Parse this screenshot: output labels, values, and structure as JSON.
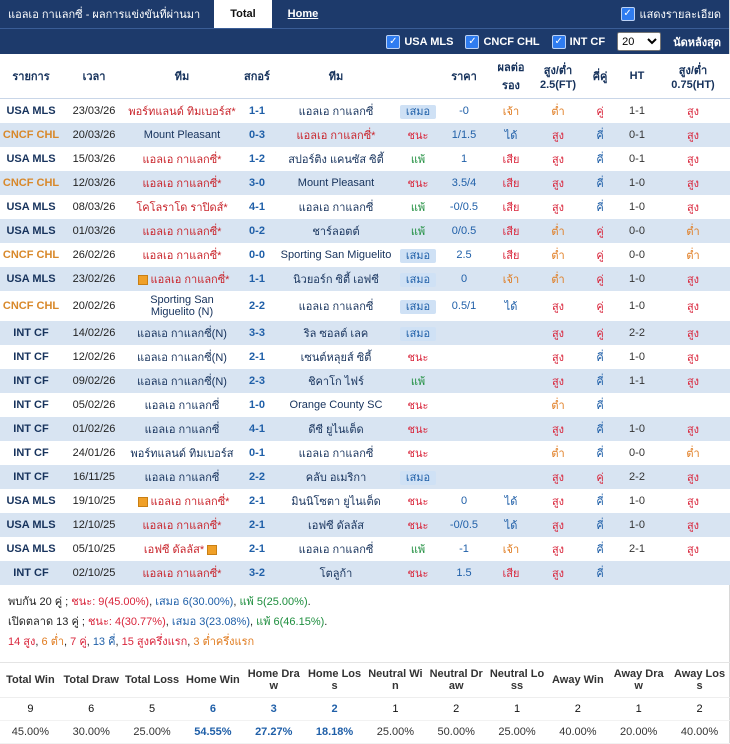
{
  "icons": {
    "check": "✓"
  },
  "titlebar": {
    "title": "แอลเอ กาแลกซี่ - ผลการแข่งขันที่ผ่านมา",
    "tabs": [
      {
        "label": "Total",
        "active": true
      },
      {
        "label": "Home",
        "active": false
      }
    ],
    "detail_label": "แสดงรายละเอียด"
  },
  "filterbar": {
    "leagues": [
      "USA MLS",
      "CNCF CHL",
      "INT CF"
    ],
    "match_count": "20",
    "match_count_label": "นัดหลังสุด"
  },
  "table": {
    "headers": [
      "รายการ",
      "เวลา",
      "ทีม",
      "สกอร์",
      "ทีม",
      "",
      "ราคา",
      "ผลต่อรอง",
      "สูง/ต่ำ 2.5(FT)",
      "คี่คู่",
      "HT",
      "สูง/ต่ำ 0.75(HT)"
    ],
    "rows": [
      {
        "league": "USA MLS",
        "league_type": "navy",
        "date": "23/03/26",
        "home": "พอร์ทแลนด์ ทิมเบอร์ส*",
        "home_fav": true,
        "home_icon": "",
        "score": "1-1",
        "away": "แอลเอ กาแลกซี่",
        "away_fav": false,
        "result": "เสมอ",
        "result_type": "draw",
        "price": "-0",
        "odds": "เจ้า",
        "odds_type": "push",
        "ou": "ต่ำ",
        "ou_type": "under",
        "oe": "คู่",
        "oe_type": "even",
        "ht": "1-1",
        "ht_ou": "สูง",
        "ht_ou_type": "over"
      },
      {
        "league": "CNCF CHL",
        "league_type": "orange",
        "date": "20/03/26",
        "home": "Mount Pleasant",
        "home_fav": false,
        "home_icon": "",
        "score": "0-3",
        "away": "แอลเอ กาแลกซี่*",
        "away_fav": true,
        "result": "ชนะ",
        "result_type": "win",
        "price": "1/1.5",
        "odds": "ได้",
        "odds_type": "gain",
        "ou": "สูง",
        "ou_type": "over",
        "oe": "คี่",
        "oe_type": "odd",
        "ht": "0-1",
        "ht_ou": "สูง",
        "ht_ou_type": "over"
      },
      {
        "league": "USA MLS",
        "league_type": "navy",
        "date": "15/03/26",
        "home": "แอลเอ กาแลกซี่*",
        "home_fav": true,
        "home_icon": "",
        "score": "1-2",
        "away": "สปอร์ติง แคนซัส ซิตี้",
        "away_fav": false,
        "result": "แพ้",
        "result_type": "loss",
        "price": "1",
        "odds": "เสีย",
        "odds_type": "lose",
        "ou": "สูง",
        "ou_type": "over",
        "oe": "คี่",
        "oe_type": "odd",
        "ht": "0-1",
        "ht_ou": "สูง",
        "ht_ou_type": "over"
      },
      {
        "league": "CNCF CHL",
        "league_type": "orange",
        "date": "12/03/26",
        "home": "แอลเอ กาแลกซี่*",
        "home_fav": true,
        "home_icon": "",
        "score": "3-0",
        "away": "Mount Pleasant",
        "away_fav": false,
        "result": "ชนะ",
        "result_type": "win",
        "price": "3.5/4",
        "odds": "เสีย",
        "odds_type": "lose",
        "ou": "สูง",
        "ou_type": "over",
        "oe": "คี่",
        "oe_type": "odd",
        "ht": "1-0",
        "ht_ou": "สูง",
        "ht_ou_type": "over"
      },
      {
        "league": "USA MLS",
        "league_type": "navy",
        "date": "08/03/26",
        "home": "โคโลราโด ราปิดส์*",
        "home_fav": true,
        "home_icon": "",
        "score": "4-1",
        "away": "แอลเอ กาแลกซี่",
        "away_fav": false,
        "result": "แพ้",
        "result_type": "loss",
        "price": "-0/0.5",
        "odds": "เสีย",
        "odds_type": "lose",
        "ou": "สูง",
        "ou_type": "over",
        "oe": "คี่",
        "oe_type": "odd",
        "ht": "1-0",
        "ht_ou": "สูง",
        "ht_ou_type": "over"
      },
      {
        "league": "USA MLS",
        "league_type": "navy",
        "date": "01/03/26",
        "home": "แอลเอ กาแลกซี่*",
        "home_fav": true,
        "home_icon": "",
        "score": "0-2",
        "away": "ชาร์ลอตต์",
        "away_fav": false,
        "result": "แพ้",
        "result_type": "loss",
        "price": "0/0.5",
        "odds": "เสีย",
        "odds_type": "lose",
        "ou": "ต่ำ",
        "ou_type": "under",
        "oe": "คู่",
        "oe_type": "even",
        "ht": "0-0",
        "ht_ou": "ต่ำ",
        "ht_ou_type": "under"
      },
      {
        "league": "CNCF CHL",
        "league_type": "orange",
        "date": "26/02/26",
        "home": "แอลเอ กาแลกซี่*",
        "home_fav": true,
        "home_icon": "",
        "score": "0-0",
        "away": "Sporting San Miguelito",
        "away_fav": false,
        "result": "เสมอ",
        "result_type": "draw",
        "price": "2.5",
        "odds": "เสีย",
        "odds_type": "lose",
        "ou": "ต่ำ",
        "ou_type": "under",
        "oe": "คู่",
        "oe_type": "even",
        "ht": "0-0",
        "ht_ou": "ต่ำ",
        "ht_ou_type": "under"
      },
      {
        "league": "USA MLS",
        "league_type": "navy",
        "date": "23/02/26",
        "home": "แอลเอ กาแลกซี่*",
        "home_fav": true,
        "home_icon": "before",
        "score": "1-1",
        "away": "นิวยอร์ก ซิตี้ เอฟซี",
        "away_fav": false,
        "result": "เสมอ",
        "result_type": "draw",
        "price": "0",
        "odds": "เจ้า",
        "odds_type": "push",
        "ou": "ต่ำ",
        "ou_type": "under",
        "oe": "คู่",
        "oe_type": "even",
        "ht": "1-0",
        "ht_ou": "สูง",
        "ht_ou_type": "over"
      },
      {
        "league": "CNCF CHL",
        "league_type": "orange",
        "date": "20/02/26",
        "home": "Sporting San Miguelito (N)",
        "home_fav": false,
        "home_icon": "",
        "score": "2-2",
        "away": "แอลเอ กาแลกซี่",
        "away_fav": false,
        "result": "เสมอ",
        "result_type": "draw",
        "price": "0.5/1",
        "odds": "ได้",
        "odds_type": "gain",
        "ou": "สูง",
        "ou_type": "over",
        "oe": "คู่",
        "oe_type": "even",
        "ht": "1-0",
        "ht_ou": "สูง",
        "ht_ou_type": "over"
      },
      {
        "league": "INT CF",
        "league_type": "navy",
        "date": "14/02/26",
        "home": "แอลเอ กาแลกซี่(N)",
        "home_fav": false,
        "home_icon": "",
        "score": "3-3",
        "away": "ริล ซอลต์ เลค",
        "away_fav": false,
        "result": "เสมอ",
        "result_type": "draw",
        "price": "",
        "odds": "",
        "odds_type": "",
        "ou": "สูง",
        "ou_type": "over",
        "oe": "คู่",
        "oe_type": "even",
        "ht": "2-2",
        "ht_ou": "สูง",
        "ht_ou_type": "over"
      },
      {
        "league": "INT CF",
        "league_type": "navy",
        "date": "12/02/26",
        "home": "แอลเอ กาแลกซี่(N)",
        "home_fav": false,
        "home_icon": "",
        "score": "2-1",
        "away": "เซนต์หลุยส์ ซิตี้",
        "away_fav": false,
        "result": "ชนะ",
        "result_type": "win",
        "price": "",
        "odds": "",
        "odds_type": "",
        "ou": "สูง",
        "ou_type": "over",
        "oe": "คี่",
        "oe_type": "odd",
        "ht": "1-0",
        "ht_ou": "สูง",
        "ht_ou_type": "over"
      },
      {
        "league": "INT CF",
        "league_type": "navy",
        "date": "09/02/26",
        "home": "แอลเอ กาแลกซี่(N)",
        "home_fav": false,
        "home_icon": "",
        "score": "2-3",
        "away": "ชิคาโก ไฟร์",
        "away_fav": false,
        "result": "แพ้",
        "result_type": "loss",
        "price": "",
        "odds": "",
        "odds_type": "",
        "ou": "สูง",
        "ou_type": "over",
        "oe": "คี่",
        "oe_type": "odd",
        "ht": "1-1",
        "ht_ou": "สูง",
        "ht_ou_type": "over"
      },
      {
        "league": "INT CF",
        "league_type": "navy",
        "date": "05/02/26",
        "home": "แอลเอ กาแลกซี่",
        "home_fav": false,
        "home_icon": "",
        "score": "1-0",
        "away": "Orange County SC",
        "away_fav": false,
        "result": "ชนะ",
        "result_type": "win",
        "price": "",
        "odds": "",
        "odds_type": "",
        "ou": "ต่ำ",
        "ou_type": "under",
        "oe": "คี่",
        "oe_type": "odd",
        "ht": "",
        "ht_ou": "",
        "ht_ou_type": ""
      },
      {
        "league": "INT CF",
        "league_type": "navy",
        "date": "01/02/26",
        "home": "แอลเอ กาแลกซี่",
        "home_fav": false,
        "home_icon": "",
        "score": "4-1",
        "away": "ดีซี ยูไนเต็ด",
        "away_fav": false,
        "result": "ชนะ",
        "result_type": "win",
        "price": "",
        "odds": "",
        "odds_type": "",
        "ou": "สูง",
        "ou_type": "over",
        "oe": "คี่",
        "oe_type": "odd",
        "ht": "1-0",
        "ht_ou": "สูง",
        "ht_ou_type": "over"
      },
      {
        "league": "INT CF",
        "league_type": "navy",
        "date": "24/01/26",
        "home": "พอร์ทแลนด์ ทิมเบอร์ส",
        "home_fav": false,
        "home_icon": "",
        "score": "0-1",
        "away": "แอลเอ กาแลกซี่",
        "away_fav": false,
        "result": "ชนะ",
        "result_type": "win",
        "price": "",
        "odds": "",
        "odds_type": "",
        "ou": "ต่ำ",
        "ou_type": "under",
        "oe": "คี่",
        "oe_type": "odd",
        "ht": "0-0",
        "ht_ou": "ต่ำ",
        "ht_ou_type": "under"
      },
      {
        "league": "INT CF",
        "league_type": "navy",
        "date": "16/11/25",
        "home": "แอลเอ กาแลกซี่",
        "home_fav": false,
        "home_icon": "",
        "score": "2-2",
        "away": "คลับ อเมริกา",
        "away_fav": false,
        "result": "เสมอ",
        "result_type": "draw",
        "price": "",
        "odds": "",
        "odds_type": "",
        "ou": "สูง",
        "ou_type": "over",
        "oe": "คู่",
        "oe_type": "even",
        "ht": "2-2",
        "ht_ou": "สูง",
        "ht_ou_type": "over"
      },
      {
        "league": "USA MLS",
        "league_type": "navy",
        "date": "19/10/25",
        "home": "แอลเอ กาแลกซี่*",
        "home_fav": true,
        "home_icon": "before",
        "score": "2-1",
        "away": "มินนิโซตา ยูไนเต็ด",
        "away_fav": false,
        "result": "ชนะ",
        "result_type": "win",
        "price": "0",
        "odds": "ได้",
        "odds_type": "gain",
        "ou": "สูง",
        "ou_type": "over",
        "oe": "คี่",
        "oe_type": "odd",
        "ht": "1-0",
        "ht_ou": "สูง",
        "ht_ou_type": "over"
      },
      {
        "league": "USA MLS",
        "league_type": "navy",
        "date": "12/10/25",
        "home": "แอลเอ กาแลกซี่*",
        "home_fav": true,
        "home_icon": "",
        "score": "2-1",
        "away": "เอฟซี ดัลลัส",
        "away_fav": false,
        "result": "ชนะ",
        "result_type": "win",
        "price": "-0/0.5",
        "odds": "ได้",
        "odds_type": "gain",
        "ou": "สูง",
        "ou_type": "over",
        "oe": "คี่",
        "oe_type": "odd",
        "ht": "1-0",
        "ht_ou": "สูง",
        "ht_ou_type": "over"
      },
      {
        "league": "USA MLS",
        "league_type": "navy",
        "date": "05/10/25",
        "home": "เอฟซี ดัลลัส*",
        "home_fav": true,
        "home_icon": "after",
        "score": "2-1",
        "away": "แอลเอ กาแลกซี่",
        "away_fav": false,
        "result": "แพ้",
        "result_type": "loss",
        "price": "-1",
        "odds": "เจ้า",
        "odds_type": "push",
        "ou": "สูง",
        "ou_type": "over",
        "oe": "คี่",
        "oe_type": "odd",
        "ht": "2-1",
        "ht_ou": "สูง",
        "ht_ou_type": "over"
      },
      {
        "league": "INT CF",
        "league_type": "navy",
        "date": "02/10/25",
        "home": "แอลเอ กาแลกซี่*",
        "home_fav": true,
        "home_icon": "",
        "score": "3-2",
        "away": "โตลูก้า",
        "away_fav": false,
        "result": "ชนะ",
        "result_type": "win",
        "price": "1.5",
        "odds": "เสีย",
        "odds_type": "lose",
        "ou": "สูง",
        "ou_type": "over",
        "oe": "คี่",
        "oe_type": "odd",
        "ht": "",
        "ht_ou": "",
        "ht_ou_type": ""
      }
    ]
  },
  "summary": {
    "lines": [
      [
        {
          "t": "พบกัน 20 คู่ ; ",
          "c": "dark"
        },
        {
          "t": "ชนะ: 9(45.00%)",
          "c": "red"
        },
        {
          "t": ", ",
          "c": "dark"
        },
        {
          "t": "เสมอ 6(30.00%)",
          "c": "blue"
        },
        {
          "t": ", ",
          "c": "dark"
        },
        {
          "t": "แพ้ 5(25.00%)",
          "c": "green"
        },
        {
          "t": ".",
          "c": "dark"
        }
      ],
      [
        {
          "t": "เปิดตลาด 13 คู่ ; ",
          "c": "dark"
        },
        {
          "t": "ชนะ: 4(30.77%)",
          "c": "red"
        },
        {
          "t": ", ",
          "c": "dark"
        },
        {
          "t": "เสมอ 3(23.08%)",
          "c": "blue"
        },
        {
          "t": ", ",
          "c": "dark"
        },
        {
          "t": "แพ้ 6(46.15%)",
          "c": "green"
        },
        {
          "t": ".",
          "c": "dark"
        }
      ],
      [
        {
          "t": "14 สูง",
          "c": "red"
        },
        {
          "t": ", ",
          "c": "dark"
        },
        {
          "t": "6 ต่ำ",
          "c": "orange"
        },
        {
          "t": ", ",
          "c": "dark"
        },
        {
          "t": "7 คู่",
          "c": "red"
        },
        {
          "t": ", ",
          "c": "dark"
        },
        {
          "t": "13 คี่",
          "c": "blue"
        },
        {
          "t": ", ",
          "c": "dark"
        },
        {
          "t": "15 สูงครึ่งแรก",
          "c": "red"
        },
        {
          "t": ", ",
          "c": "dark"
        },
        {
          "t": "3 ต่ำครึ่งแรก",
          "c": "orange"
        }
      ]
    ]
  },
  "stats": {
    "headers": [
      "Total Win",
      "Total Draw",
      "Total Loss",
      "Home Win",
      "Home Draw",
      "Home Loss",
      "Neutral Win",
      "Neutral Draw",
      "Neutral Loss",
      "Away Win",
      "Away Draw",
      "Away Loss"
    ],
    "counts": [
      "9",
      "6",
      "5",
      "6",
      "3",
      "2",
      "1",
      "2",
      "1",
      "2",
      "1",
      "2"
    ],
    "percents": [
      "45.00%",
      "30.00%",
      "25.00%",
      "54.55%",
      "27.27%",
      "18.18%",
      "25.00%",
      "50.00%",
      "25.00%",
      "40.00%",
      "20.00%",
      "40.00%"
    ],
    "highlight_cols": [
      3,
      4,
      5
    ]
  }
}
